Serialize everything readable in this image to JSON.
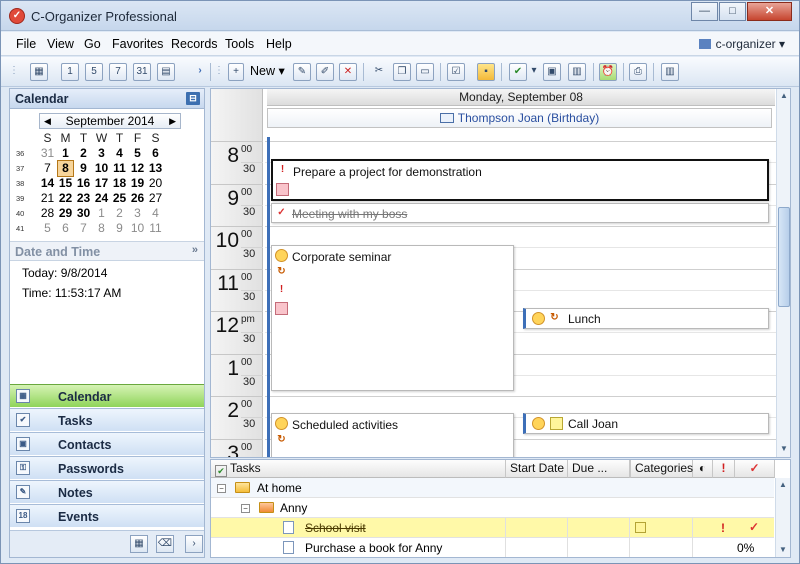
{
  "window": {
    "title": "C-Organizer Professional",
    "min": "—",
    "max": "□",
    "close": "✕"
  },
  "menu": {
    "items": [
      "File",
      "View",
      "Go",
      "Favorites",
      "Records",
      "Tools",
      "Help"
    ],
    "user": "c-organizer"
  },
  "toolbar": {
    "new_label": "New"
  },
  "left_pane": {
    "title": "Calendar",
    "month_label": "September 2014",
    "weekdays": [
      "S",
      "M",
      "T",
      "W",
      "T",
      "F",
      "S"
    ],
    "weeks": [
      {
        "wk": "36",
        "days": [
          {
            "d": "31",
            "s": "g"
          },
          {
            "d": "1",
            "s": "b"
          },
          {
            "d": "2",
            "s": "b"
          },
          {
            "d": "3",
            "s": "b"
          },
          {
            "d": "4",
            "s": "b"
          },
          {
            "d": "5",
            "s": "b"
          },
          {
            "d": "6",
            "s": "b"
          }
        ]
      },
      {
        "wk": "37",
        "days": [
          {
            "d": "7",
            "s": "n"
          },
          {
            "d": "8",
            "s": "today"
          },
          {
            "d": "9",
            "s": "b"
          },
          {
            "d": "10",
            "s": "b"
          },
          {
            "d": "11",
            "s": "b"
          },
          {
            "d": "12",
            "s": "b"
          },
          {
            "d": "13",
            "s": "b"
          }
        ]
      },
      {
        "wk": "38",
        "days": [
          {
            "d": "14",
            "s": "b"
          },
          {
            "d": "15",
            "s": "b"
          },
          {
            "d": "16",
            "s": "b"
          },
          {
            "d": "17",
            "s": "b"
          },
          {
            "d": "18",
            "s": "b"
          },
          {
            "d": "19",
            "s": "b"
          },
          {
            "d": "20",
            "s": "n"
          }
        ]
      },
      {
        "wk": "39",
        "days": [
          {
            "d": "21",
            "s": "n"
          },
          {
            "d": "22",
            "s": "b"
          },
          {
            "d": "23",
            "s": "b"
          },
          {
            "d": "24",
            "s": "b"
          },
          {
            "d": "25",
            "s": "b"
          },
          {
            "d": "26",
            "s": "b"
          },
          {
            "d": "27",
            "s": "n"
          }
        ]
      },
      {
        "wk": "40",
        "days": [
          {
            "d": "28",
            "s": "n"
          },
          {
            "d": "29",
            "s": "b"
          },
          {
            "d": "30",
            "s": "b"
          },
          {
            "d": "1",
            "s": "g"
          },
          {
            "d": "2",
            "s": "g"
          },
          {
            "d": "3",
            "s": "g"
          },
          {
            "d": "4",
            "s": "g"
          }
        ]
      },
      {
        "wk": "41",
        "days": [
          {
            "d": "5",
            "s": "g"
          },
          {
            "d": "6",
            "s": "g"
          },
          {
            "d": "7",
            "s": "g"
          },
          {
            "d": "8",
            "s": "g"
          },
          {
            "d": "9",
            "s": "g"
          },
          {
            "d": "10",
            "s": "g"
          },
          {
            "d": "11",
            "s": "g"
          }
        ]
      }
    ],
    "date_time_title": "Date and Time",
    "today_line": "Today: 9/8/2014",
    "time_line": "Time: 11:53:17 AM",
    "nav": [
      "Calendar",
      "Tasks",
      "Contacts",
      "Passwords",
      "Notes",
      "Events"
    ]
  },
  "day_view": {
    "date_header": "Monday, September 08",
    "birthday": "Thompson Joan (Birthday)",
    "hours": [
      {
        "h": "8",
        "m": "00"
      },
      {
        "h": "9",
        "m": "00"
      },
      {
        "h": "10",
        "m": "00"
      },
      {
        "h": "11",
        "m": "00"
      },
      {
        "h": "12",
        "m": "pm"
      },
      {
        "h": "1",
        "m": "00"
      },
      {
        "h": "2",
        "m": "00"
      },
      {
        "h": "3",
        "m": "00"
      }
    ],
    "half_label": "30",
    "appointments": {
      "project": "Prepare a project for demonstration",
      "meeting": "Meeting with my boss",
      "seminar": "Corporate seminar",
      "lunch": "Lunch",
      "scheduled": "Scheduled activities",
      "call": "Call Joan"
    }
  },
  "tasks": {
    "headers": {
      "tasks": "Tasks",
      "start": "Start Date",
      "due": "Due ...",
      "categories": "Categories"
    },
    "rows": {
      "group": "At home",
      "person": "Anny",
      "task1": "School visit",
      "task2": "Purchase a book for Anny",
      "task2_pct": "0%"
    }
  }
}
